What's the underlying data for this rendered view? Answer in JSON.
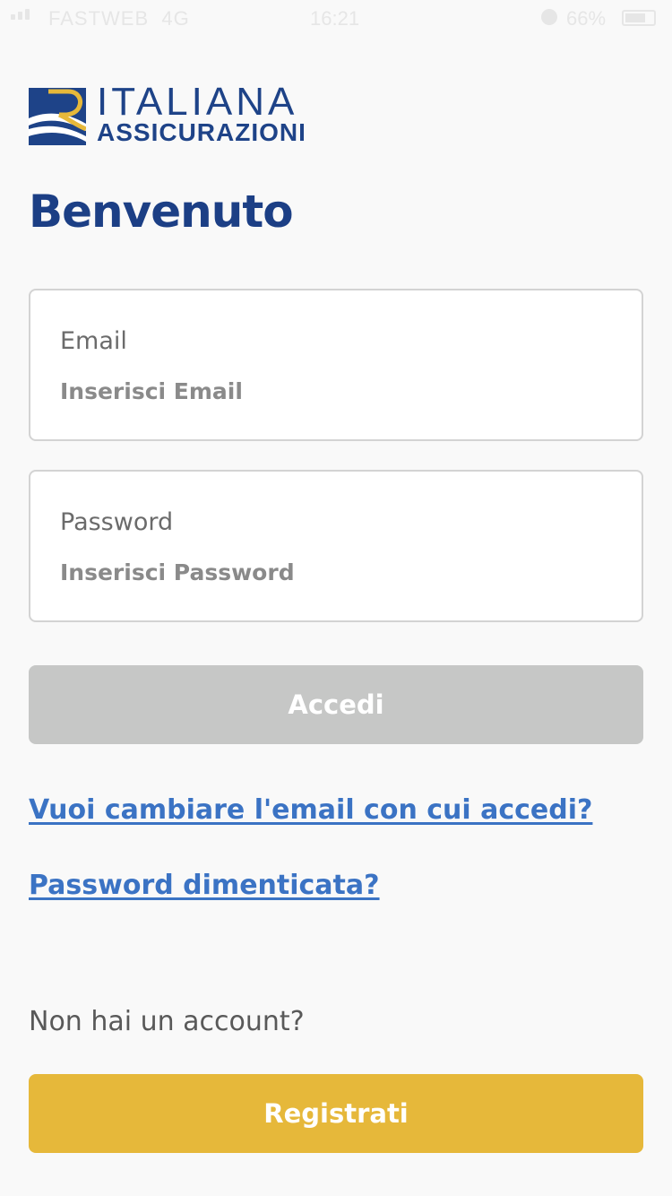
{
  "status_bar": {
    "carrier": "FASTWEB",
    "network": "4G",
    "time": "16:21",
    "battery_percent": "66%"
  },
  "logo": {
    "line1": "ITALIANA",
    "line2": "ASSICURAZIONI",
    "colors": {
      "blue": "#1e4388",
      "gold": "#e6b83a"
    }
  },
  "welcome": {
    "title": "Benvenuto"
  },
  "form": {
    "email": {
      "label": "Email",
      "placeholder": "Inserisci Email",
      "value": ""
    },
    "password": {
      "label": "Password",
      "placeholder": "Inserisci Password",
      "value": ""
    },
    "login_button": "Accedi"
  },
  "links": {
    "change_email": "Vuoi cambiare l'email con cui accedi?",
    "forgot_password": "Password dimenticata?"
  },
  "signup": {
    "prompt": "Non hai un account?",
    "button": "Registrati"
  },
  "colors": {
    "title": "#1c3f85",
    "link": "#3b73c4",
    "disabled_button": "#c6c7c6",
    "register_button": "#e6b83a"
  }
}
